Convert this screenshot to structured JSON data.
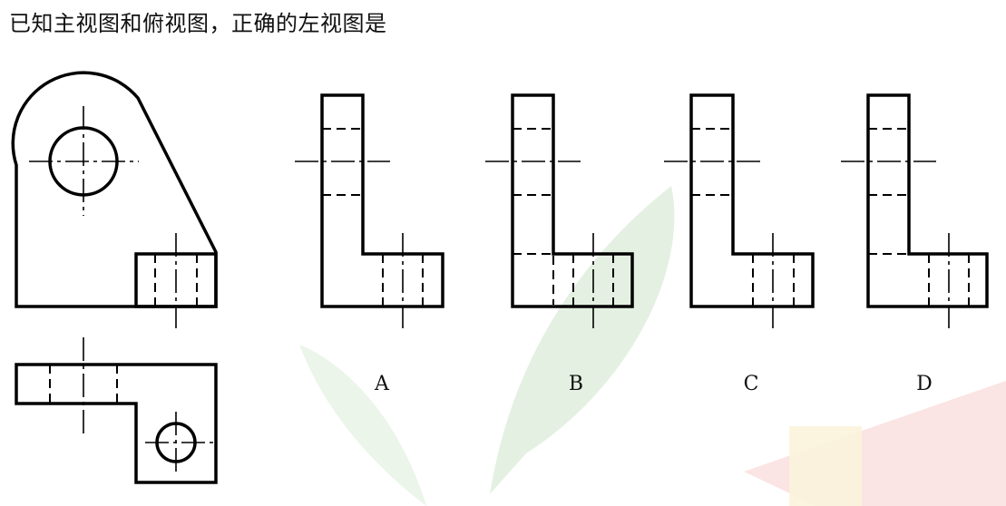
{
  "question": {
    "text": "已知主视图和俯视图，正确的左视图是"
  },
  "options": [
    {
      "letter": "A"
    },
    {
      "letter": "B"
    },
    {
      "letter": "C"
    },
    {
      "letter": "D"
    }
  ],
  "colors": {
    "line": "#000000",
    "watermark_leaf": "#dcefdc",
    "watermark_red": "#fbe3e3",
    "watermark_yellow": "#fbf3d8"
  }
}
